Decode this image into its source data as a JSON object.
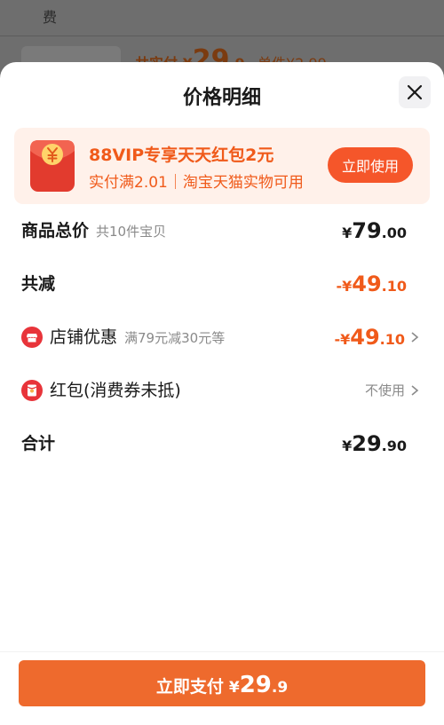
{
  "background": {
    "fee_label": "费",
    "price_prefix": "共实付",
    "price_currency": "¥",
    "price_int": "29",
    "price_dec": ".9",
    "unit_label": "单件¥2.99"
  },
  "sheet": {
    "title": "价格明细",
    "close_icon": "close-icon"
  },
  "promo": {
    "title": "88VIP专享天天红包2元",
    "subtitle": "实付满2.01｜淘宝天猫实物可用",
    "button": "立即使用",
    "icon": "red-envelope-icon"
  },
  "rows": {
    "total": {
      "label": "商品总价",
      "sub": "共10件宝贝",
      "currency": "¥",
      "int": "79",
      "dec": ".00"
    },
    "discount": {
      "label": "共减",
      "prefix": "-",
      "currency": "¥",
      "int": "49",
      "dec": ".10"
    },
    "store_coupon": {
      "label": "店铺优惠",
      "sub": "满79元减30元等",
      "prefix": "-",
      "currency": "¥",
      "int": "49",
      "dec": ".10",
      "icon": "store-icon"
    },
    "red_packet": {
      "label": "红包(消费券未抵)",
      "value": "不使用",
      "icon": "red-packet-icon"
    },
    "sum": {
      "label": "合计",
      "currency": "¥",
      "int": "29",
      "dec": ".90"
    }
  },
  "footer": {
    "pay_label": "立即支付",
    "currency": "¥",
    "int": "29",
    "dec": ".9"
  },
  "colors": {
    "accent": "#f05a1a",
    "pay_button": "#ee6a2d",
    "promo_bg": "#fff1ea"
  }
}
